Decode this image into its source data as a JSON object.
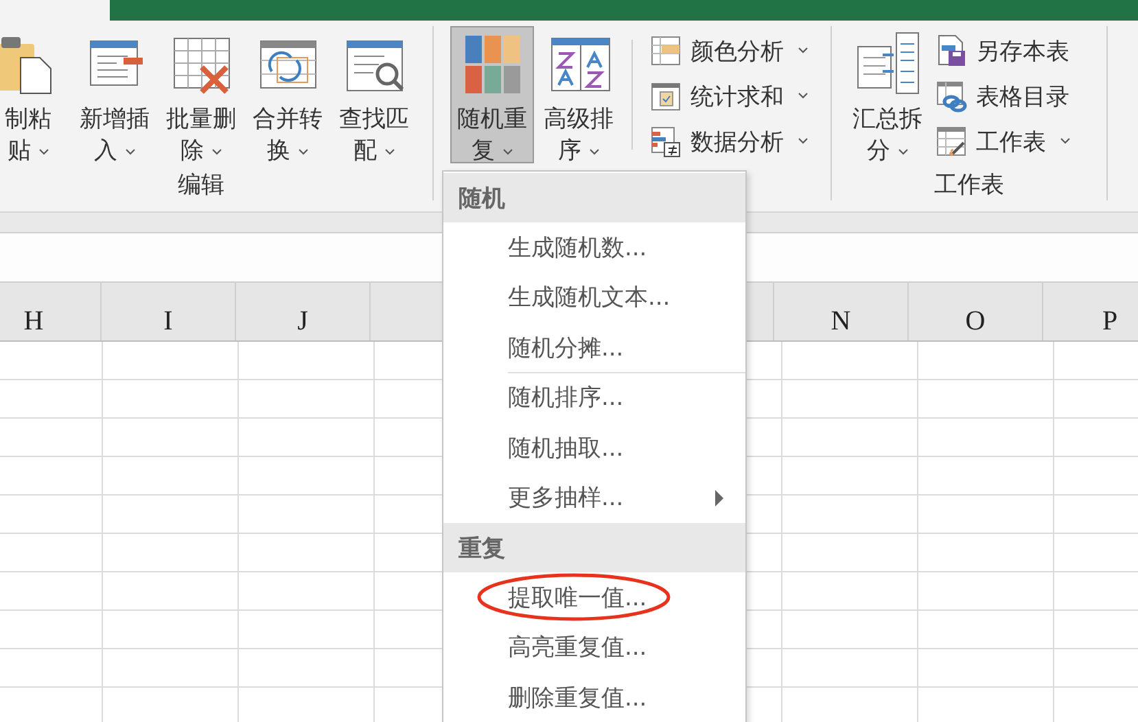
{
  "ribbon": {
    "groups": [
      {
        "label": "编辑",
        "large_buttons": [
          {
            "lines": [
              "制粘",
              "贴"
            ],
            "dropdown": true,
            "pressed": false
          },
          {
            "lines": [
              "新增插",
              "入"
            ],
            "dropdown": true,
            "pressed": false
          },
          {
            "lines": [
              "批量删",
              "除"
            ],
            "dropdown": true,
            "pressed": false
          },
          {
            "lines": [
              "合并转",
              "换"
            ],
            "dropdown": true,
            "pressed": false
          },
          {
            "lines": [
              "查找匹",
              "配"
            ],
            "dropdown": true,
            "pressed": false
          }
        ]
      },
      {
        "large_buttons": [
          {
            "lines": [
              "随机重",
              "复"
            ],
            "dropdown": true,
            "pressed": true
          },
          {
            "lines": [
              "高级排",
              "序"
            ],
            "dropdown": true,
            "pressed": false
          }
        ],
        "small_buttons": [
          {
            "label": "颜色分析",
            "dropdown": true
          },
          {
            "label": "统计求和",
            "dropdown": true
          },
          {
            "label": "数据分析",
            "dropdown": true
          }
        ]
      },
      {
        "label": "工作表",
        "large_buttons": [
          {
            "lines": [
              "汇总拆",
              "分"
            ],
            "dropdown": true,
            "pressed": false
          }
        ],
        "small_buttons": [
          {
            "label": "另存本表",
            "dropdown": false
          },
          {
            "label": "表格目录",
            "dropdown": false
          },
          {
            "label": "工作表",
            "dropdown": true
          }
        ]
      }
    ]
  },
  "sheet": {
    "columns_left": [
      "H",
      "I",
      "J"
    ],
    "columns_right": [
      "N",
      "O",
      "P"
    ]
  },
  "menu": {
    "sections": [
      {
        "header": "随机",
        "items": [
          {
            "label": "生成随机数...",
            "submenu": false,
            "circled": false,
            "separator_after": false
          },
          {
            "label": "生成随机文本...",
            "submenu": false,
            "circled": false,
            "separator_after": false
          },
          {
            "label": "随机分摊...",
            "submenu": false,
            "circled": false,
            "separator_after": true
          },
          {
            "label": "随机排序...",
            "submenu": false,
            "circled": false,
            "separator_after": false
          },
          {
            "label": "随机抽取...",
            "submenu": false,
            "circled": false,
            "separator_after": false
          },
          {
            "label": "更多抽样...",
            "submenu": true,
            "circled": false,
            "separator_after": false
          }
        ]
      },
      {
        "header": "重复",
        "items": [
          {
            "label": "提取唯一值...",
            "submenu": false,
            "circled": true,
            "separator_after": false
          },
          {
            "label": "高亮重复值...",
            "submenu": false,
            "circled": false,
            "separator_after": false
          },
          {
            "label": "删除重复值...",
            "submenu": false,
            "circled": false,
            "separator_after": false
          }
        ]
      }
    ]
  }
}
